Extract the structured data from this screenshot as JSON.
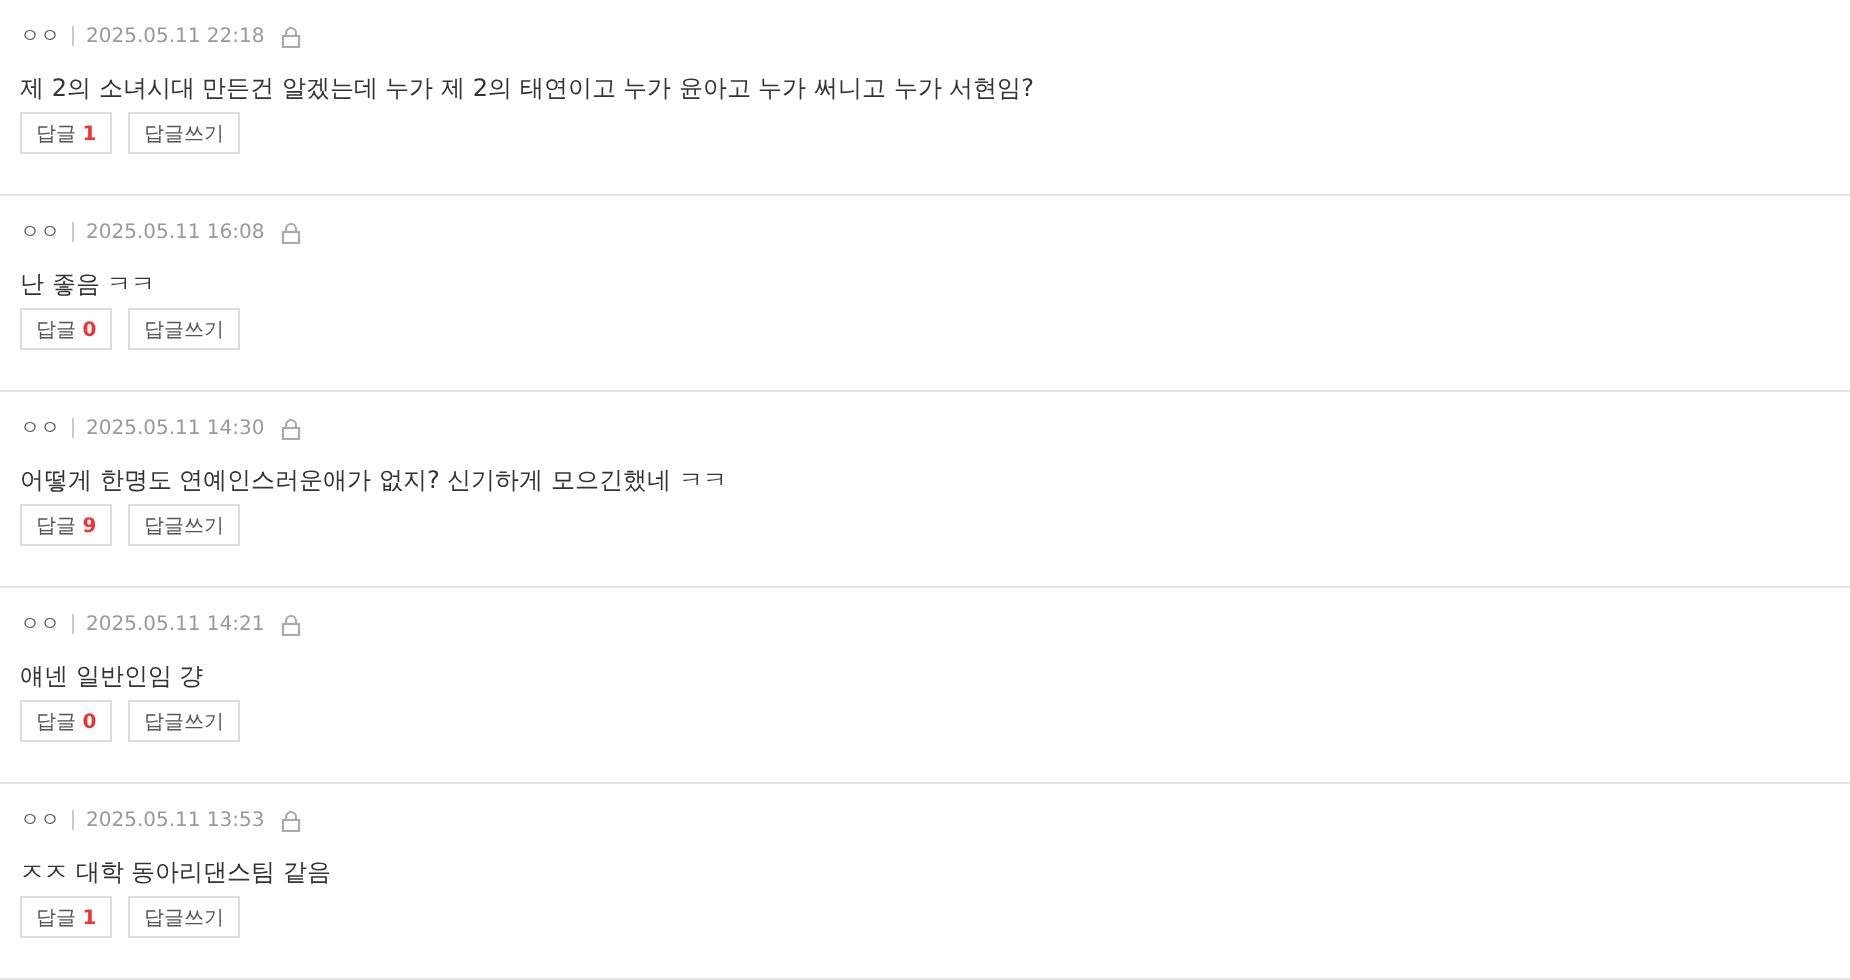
{
  "comments": [
    {
      "author": "ㅇㅇ",
      "date": "2025.05.11 22:18",
      "text": "제 2의 소녀시대 만든건 알겠는데 누가 제 2의 태연이고 누가 윤아고 누가 써니고 누가 서현임?",
      "reply_label": "답글",
      "reply_count": "1",
      "write_label": "답글쓰기"
    },
    {
      "author": "ㅇㅇ",
      "date": "2025.05.11 16:08",
      "text": "난 좋음 ㅋㅋ",
      "reply_label": "답글",
      "reply_count": "0",
      "write_label": "답글쓰기"
    },
    {
      "author": "ㅇㅇ",
      "date": "2025.05.11 14:30",
      "text": "어떻게 한명도 연예인스러운애가 없지? 신기하게 모으긴했네 ㅋㅋ",
      "reply_label": "답글",
      "reply_count": "9",
      "write_label": "답글쓰기"
    },
    {
      "author": "ㅇㅇ",
      "date": "2025.05.11 14:21",
      "text": "얘넨 일반인임 걍",
      "reply_label": "답글",
      "reply_count": "0",
      "write_label": "답글쓰기"
    },
    {
      "author": "ㅇㅇ",
      "date": "2025.05.11 13:53",
      "text": "ㅈㅈ 대학 동아리댄스팀 같음",
      "reply_label": "답글",
      "reply_count": "1",
      "write_label": "답글쓰기"
    }
  ]
}
